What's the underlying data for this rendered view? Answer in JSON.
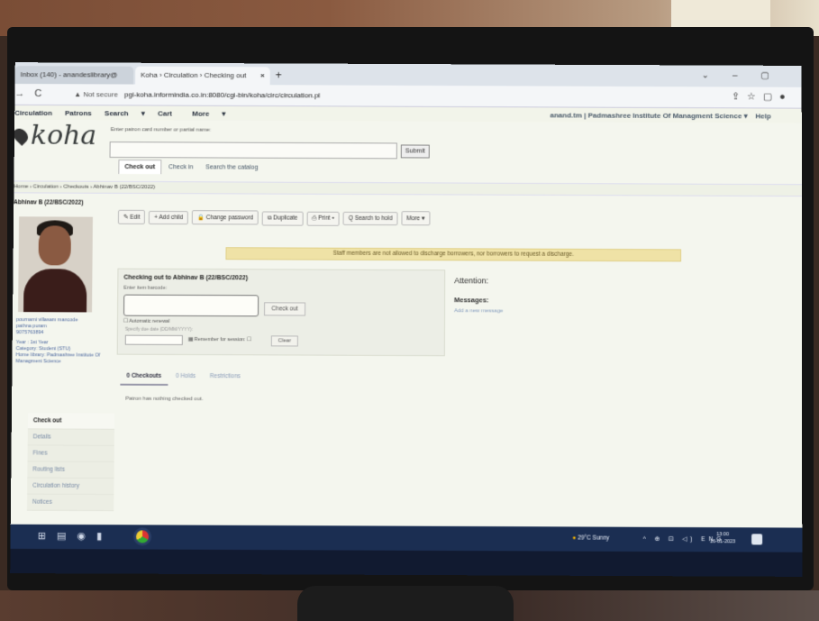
{
  "browser": {
    "tab1": "Inbox (140) - anandeslibrary@",
    "tab2": "Koha › Circulation › Checking out",
    "tab_close": "×",
    "new_tab": "+",
    "not_secure": "Not secure",
    "url": "pgi-koha.informindia.co.in:8080/cgi-bin/koha/circ/circulation.pl"
  },
  "koha_nav": {
    "items": [
      "Circulation",
      "Patrons",
      "Search",
      "Cart",
      "More"
    ],
    "user": "anand.tm | Padmashree Institute Of Managment Science",
    "help": "Help"
  },
  "search": {
    "hint": "Enter patron card number or partial name:",
    "submit": "Submit",
    "tabs": [
      "Check out",
      "Check in",
      "Search the catalog"
    ]
  },
  "breadcrumb": "Home › Circulation › Checkouts › Abhinav B (22/BSC/2022)",
  "patron": {
    "name": "Abhinav B (22/BSC/2022)",
    "address1": "pournami villasam mancode",
    "address2": "pathna puram",
    "phone": "9075763894",
    "email": "",
    "year": "Year : 1st Year",
    "category": "Category: Student (STU)",
    "library": "Home library: Padmashree Institute Of Managment Science"
  },
  "sidemenu": [
    "Check out",
    "Details",
    "Fines",
    "Routing lists",
    "Circulation history",
    "Notices"
  ],
  "toolbar": [
    "✎ Edit",
    "+ Add child",
    "🔒 Change password",
    "⧉ Duplicate",
    "⎙ Print ▾",
    "Q Search to hold",
    "More ▾"
  ],
  "warning": "Staff members are not allowed to discharge borrowers, nor borrowers to request a discharge.",
  "checkout": {
    "title": "Checking out to Abhinav B (22/BSC/2022)",
    "hint": "Enter item barcode:",
    "button": "Check out",
    "auto_renew": "Automatic renewal",
    "due_hint": "Specify due date (DD/MM/YYYY):",
    "remember": "Remember for session:",
    "clear": "Clear"
  },
  "attention": {
    "title": "Attention:",
    "messages": "Messages:",
    "add": "Add a new message"
  },
  "issue_tabs": [
    "0 Checkouts",
    "0 Holds",
    "Restrictions"
  ],
  "nothing_checked_out": "Patron has nothing checked out.",
  "taskbar": {
    "weather": "29°C Sunny",
    "tray": "^ ⊕ ⊡ ◁) ENG",
    "time": "13:00",
    "date": "16-01-2023"
  }
}
